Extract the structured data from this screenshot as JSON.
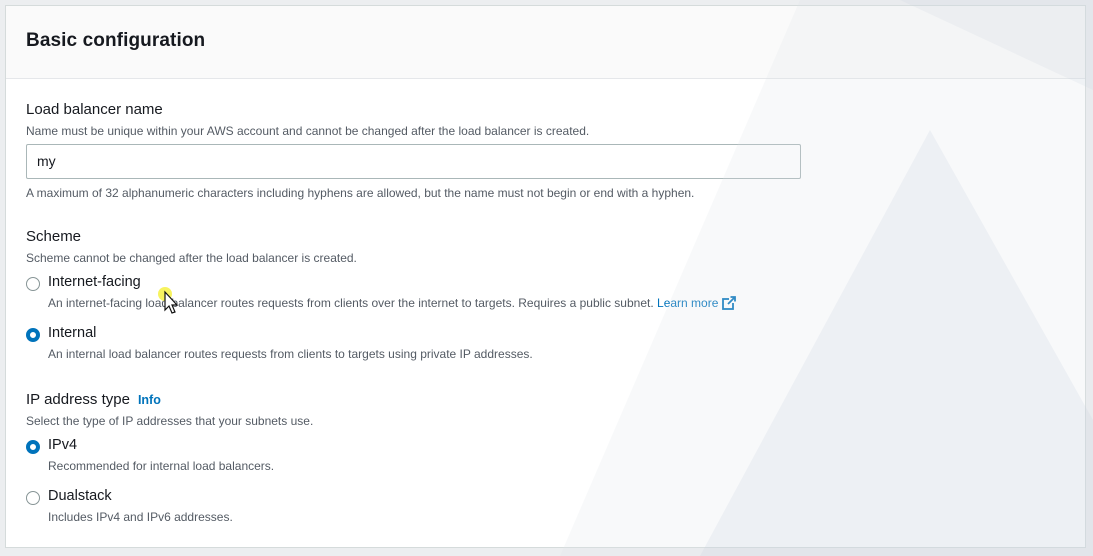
{
  "panel": {
    "title": "Basic configuration"
  },
  "load_balancer_name": {
    "label": "Load balancer name",
    "description": "Name must be unique within your AWS account and cannot be changed after the load balancer is created.",
    "value": "my",
    "constraint": "A maximum of 32 alphanumeric characters including hyphens are allowed, but the name must not begin or end with a hyphen."
  },
  "scheme": {
    "label": "Scheme",
    "description": "Scheme cannot be changed after the load balancer is created.",
    "options": [
      {
        "label": "Internet-facing",
        "description": "An internet-facing load balancer routes requests from clients over the internet to targets. Requires a public subnet.",
        "link": "Learn more",
        "selected": false
      },
      {
        "label": "Internal",
        "description": "An internal load balancer routes requests from clients to targets using private IP addresses.",
        "selected": true
      }
    ]
  },
  "ip_address_type": {
    "label": "IP address type",
    "info": "Info",
    "description": "Select the type of IP addresses that your subnets use.",
    "options": [
      {
        "label": "IPv4",
        "description": "Recommended for internal load balancers.",
        "selected": true
      },
      {
        "label": "Dualstack",
        "description": "Includes IPv4 and IPv6 addresses.",
        "selected": false
      }
    ]
  },
  "colors": {
    "accent": "#0073bb",
    "text": "#16191f",
    "muted": "#545b64"
  },
  "icons": [
    "external-link-icon",
    "cursor-icon"
  ]
}
